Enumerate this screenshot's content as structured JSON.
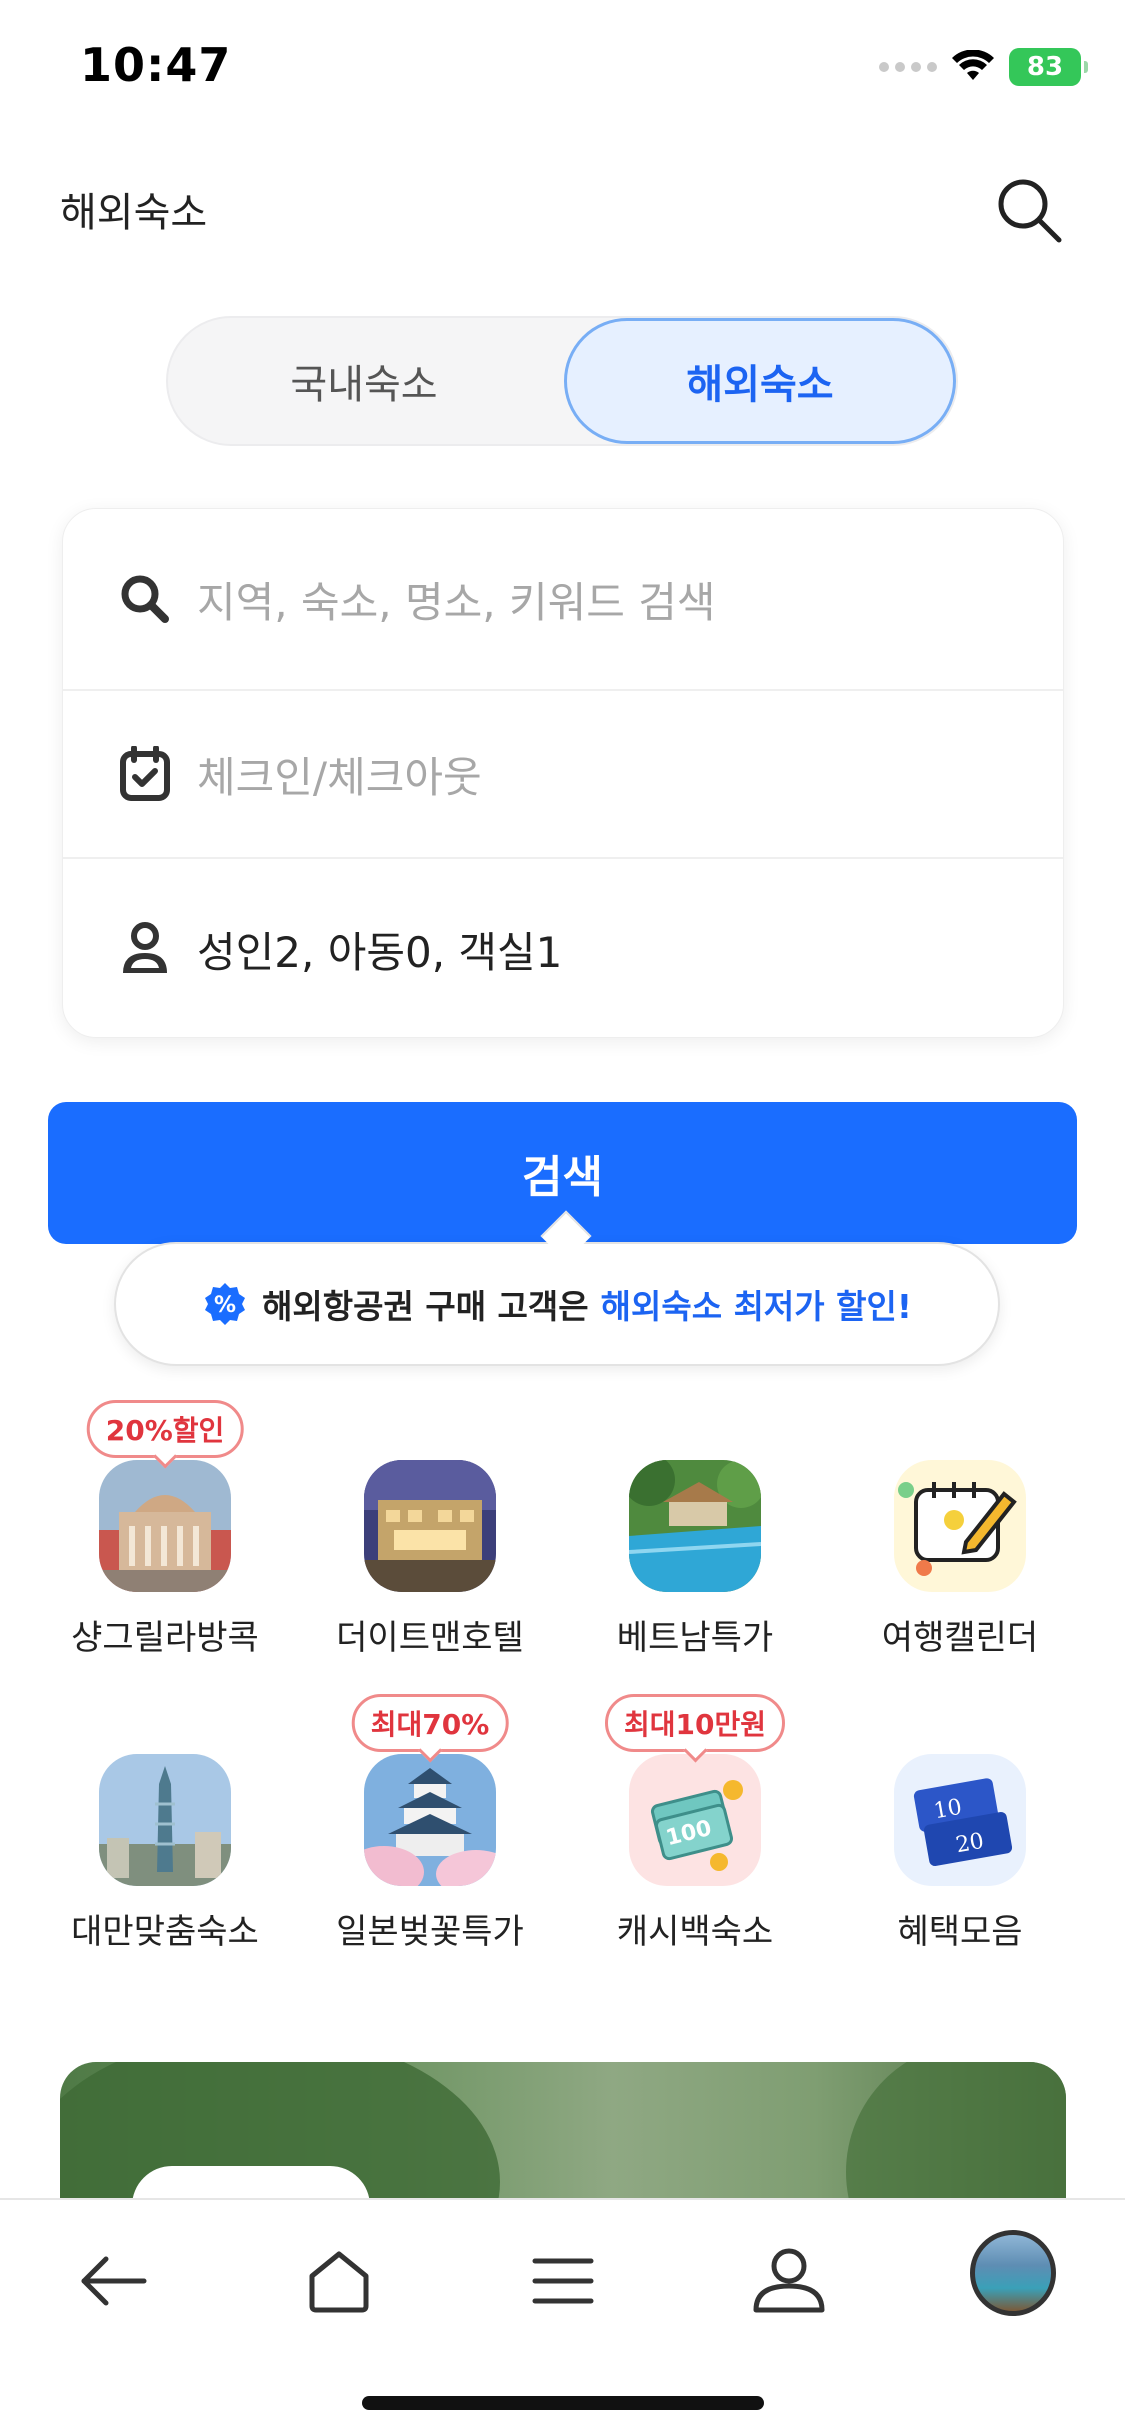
{
  "status_bar": {
    "time": "10:47",
    "battery": "83"
  },
  "header": {
    "title": "해외숙소"
  },
  "tabs": [
    {
      "label": "국내숙소",
      "selected": false
    },
    {
      "label": "해외숙소",
      "selected": true
    }
  ],
  "search_form": {
    "keyword_placeholder": "지역, 숙소, 명소, 키워드 검색",
    "dates_placeholder": "체크인/체크아웃",
    "guests_value": "성인2, 아동0, 객실1"
  },
  "search_button_label": "검색",
  "promo": {
    "text": "해외항공권 구매 고객은",
    "highlight": "해외숙소 최저가 할인!"
  },
  "categories": [
    {
      "label": "샹그릴라방콕",
      "badge": "20%할인",
      "icon": "palace-photo"
    },
    {
      "label": "더이트맨호텔",
      "badge": "",
      "icon": "hotel-photo"
    },
    {
      "label": "베트남특가",
      "badge": "",
      "icon": "resort-pool-photo"
    },
    {
      "label": "여행캘린더",
      "badge": "",
      "icon": "calendar-icon"
    },
    {
      "label": "대만맞춤숙소",
      "badge": "",
      "icon": "taipei-tower-photo"
    },
    {
      "label": "일본벚꽃특가",
      "badge": "최대70%",
      "icon": "japan-castle-photo"
    },
    {
      "label": "캐시백숙소",
      "badge": "최대10만원",
      "icon": "cash-icon"
    },
    {
      "label": "혜택모음",
      "badge": "",
      "icon": "coupon-icon"
    }
  ],
  "colors": {
    "accent": "#1a6dff",
    "badge_red": "#e0353e",
    "battery_green": "#34c759"
  },
  "bottom_nav": [
    "back-icon",
    "home-icon",
    "menu-icon",
    "profile-icon",
    "avatar"
  ]
}
